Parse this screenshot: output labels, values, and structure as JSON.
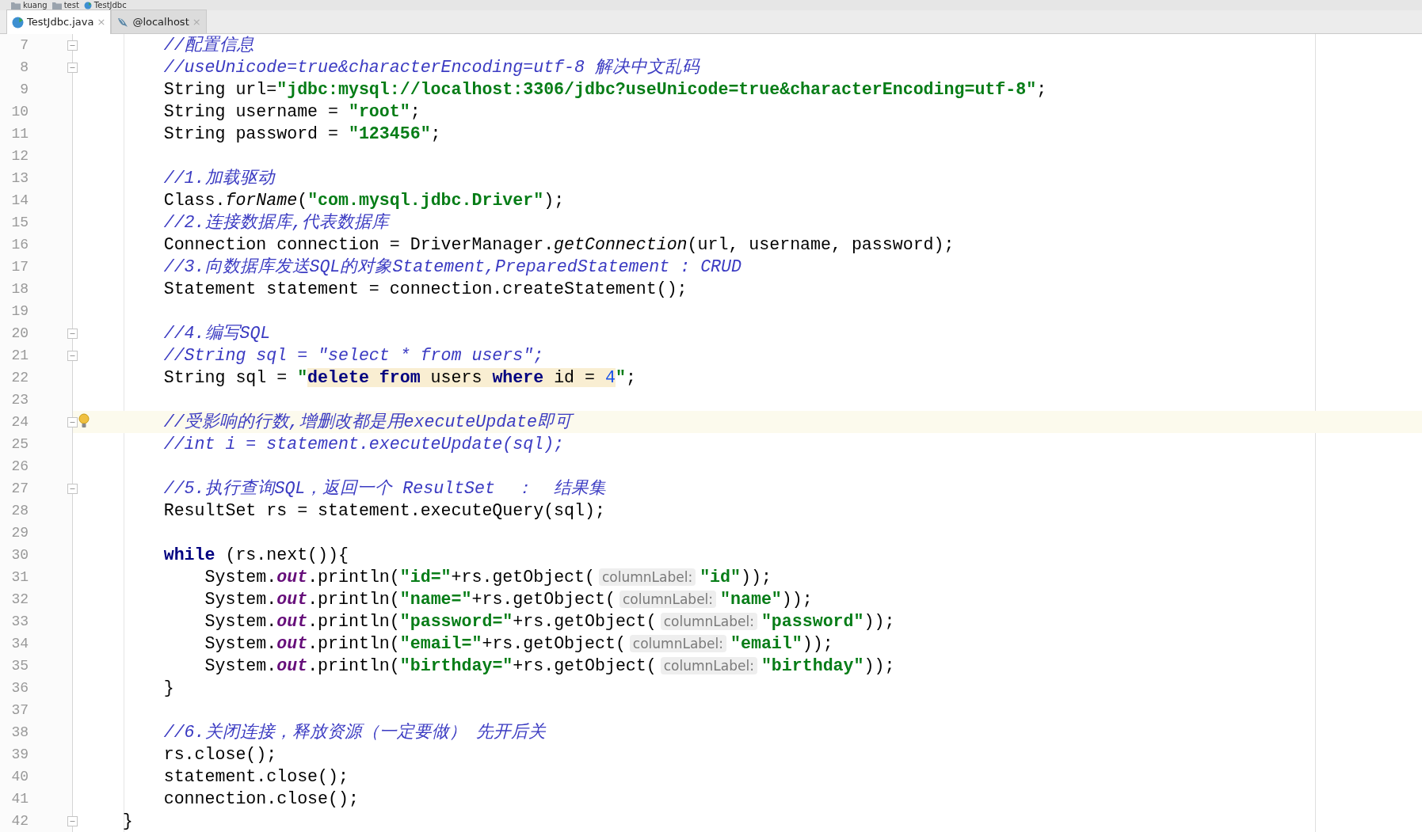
{
  "breadcrumbs": [
    {
      "kind": "folder",
      "label": "kuang"
    },
    {
      "kind": "folder",
      "label": "test"
    },
    {
      "kind": "class",
      "label": "TestJdbc"
    }
  ],
  "tabs": [
    {
      "kind": "class",
      "label": "TestJdbc.java",
      "close": "×",
      "selected": true
    },
    {
      "kind": "database",
      "label": "@localhost",
      "close": "×",
      "selected": false
    }
  ],
  "lines": [
    {
      "number": "7",
      "fold_marker": true,
      "current": false,
      "bulb": false,
      "segments": [
        {
          "kind": "comment",
          "text": "        //配置信息"
        }
      ]
    },
    {
      "number": "8",
      "fold_marker": true,
      "current": false,
      "bulb": false,
      "segments": [
        {
          "kind": "comment",
          "text": "        //useUnicode=true&characterEncoding=utf-8 解决中文乱码"
        }
      ]
    },
    {
      "number": "9",
      "fold_marker": false,
      "current": false,
      "bulb": false,
      "segments": [
        {
          "kind": "plain",
          "text": "        String url="
        },
        {
          "kind": "string",
          "text": "\"jdbc:mysql://localhost:3306/jdbc?useUnicode=true&characterEncoding=utf-8\""
        },
        {
          "kind": "plain",
          "text": ";"
        }
      ]
    },
    {
      "number": "10",
      "fold_marker": false,
      "current": false,
      "bulb": false,
      "segments": [
        {
          "kind": "plain",
          "text": "        String username = "
        },
        {
          "kind": "string",
          "text": "\"root\""
        },
        {
          "kind": "plain",
          "text": ";"
        }
      ]
    },
    {
      "number": "11",
      "fold_marker": false,
      "current": false,
      "bulb": false,
      "segments": [
        {
          "kind": "plain",
          "text": "        String password = "
        },
        {
          "kind": "string",
          "text": "\"123456\""
        },
        {
          "kind": "plain",
          "text": ";"
        }
      ]
    },
    {
      "number": "12",
      "fold_marker": false,
      "current": false,
      "bulb": false
    },
    {
      "number": "13",
      "fold_marker": false,
      "current": false,
      "bulb": false,
      "segments": [
        {
          "kind": "comment",
          "text": "        //1.加载驱动"
        }
      ]
    },
    {
      "number": "14",
      "fold_marker": false,
      "current": false,
      "bulb": false,
      "segments": [
        {
          "kind": "plain",
          "text": "        Class."
        },
        {
          "kind": "method",
          "text": "forName"
        },
        {
          "kind": "plain",
          "text": "("
        },
        {
          "kind": "string",
          "text": "\"com.mysql.jdbc.Driver\""
        },
        {
          "kind": "plain",
          "text": ");"
        }
      ]
    },
    {
      "number": "15",
      "fold_marker": false,
      "current": false,
      "bulb": false,
      "segments": [
        {
          "kind": "comment",
          "text": "        //2.连接数据库,代表数据库"
        }
      ]
    },
    {
      "number": "16",
      "fold_marker": false,
      "current": false,
      "bulb": false,
      "segments": [
        {
          "kind": "plain",
          "text": "        Connection connection = DriverManager."
        },
        {
          "kind": "method",
          "text": "getConnection"
        },
        {
          "kind": "plain",
          "text": "(url, username, password);"
        }
      ]
    },
    {
      "number": "17",
      "fold_marker": false,
      "current": false,
      "bulb": false,
      "segments": [
        {
          "kind": "comment",
          "text": "        //3.向数据库发送SQL的对象Statement,PreparedStatement : CRUD"
        }
      ]
    },
    {
      "number": "18",
      "fold_marker": false,
      "current": false,
      "bulb": false,
      "segments": [
        {
          "kind": "plain",
          "text": "        Statement statement = connection.createStatement();"
        }
      ]
    },
    {
      "number": "19",
      "fold_marker": false,
      "current": false,
      "bulb": false
    },
    {
      "number": "20",
      "fold_marker": true,
      "current": false,
      "bulb": false,
      "segments": [
        {
          "kind": "comment",
          "text": "        //4.编写SQL"
        }
      ]
    },
    {
      "number": "21",
      "fold_marker": true,
      "current": false,
      "bulb": false,
      "segments": [
        {
          "kind": "comment",
          "text": "        //String sql = \"select * from users\";"
        }
      ]
    },
    {
      "number": "22",
      "fold_marker": false,
      "current": false,
      "bulb": false,
      "segments": [
        {
          "kind": "plain",
          "text": "        String sql = "
        },
        {
          "kind": "string",
          "text": "\""
        },
        {
          "kind": "sql_keyword",
          "text": "delete from"
        },
        {
          "kind": "sql",
          "text": " users "
        },
        {
          "kind": "sql_keyword",
          "text": "where"
        },
        {
          "kind": "sql",
          "text": " id = "
        },
        {
          "kind": "sql_number",
          "text": "4"
        },
        {
          "kind": "string",
          "text": "\""
        },
        {
          "kind": "plain",
          "text": ";"
        }
      ]
    },
    {
      "number": "23",
      "fold_marker": false,
      "current": false,
      "bulb": false
    },
    {
      "number": "24",
      "fold_marker": true,
      "current": true,
      "bulb": true,
      "segments": [
        {
          "kind": "comment",
          "text": "        //受影响的行数,增删改都是用executeUpdate即可"
        }
      ]
    },
    {
      "number": "25",
      "fold_marker": false,
      "current": false,
      "bulb": false,
      "segments": [
        {
          "kind": "comment",
          "text": "        //int i = statement.executeUpdate(sql);"
        }
      ]
    },
    {
      "number": "26",
      "fold_marker": false,
      "current": false,
      "bulb": false
    },
    {
      "number": "27",
      "fold_marker": true,
      "current": false,
      "bulb": false,
      "segments": [
        {
          "kind": "comment",
          "text": "        //5.执行查询SQL，返回一个 ResultSet  ：  结果集"
        }
      ]
    },
    {
      "number": "28",
      "fold_marker": false,
      "current": false,
      "bulb": false,
      "segments": [
        {
          "kind": "plain",
          "text": "        ResultSet rs = statement.executeQuery(sql);"
        }
      ]
    },
    {
      "number": "29",
      "fold_marker": false,
      "current": false,
      "bulb": false
    },
    {
      "number": "30",
      "fold_marker": false,
      "current": false,
      "bulb": false,
      "segments": [
        {
          "kind": "keyword",
          "text": "        while"
        },
        {
          "kind": "plain",
          "text": " (rs.next()){"
        }
      ]
    },
    {
      "number": "31",
      "fold_marker": false,
      "current": false,
      "bulb": false,
      "segments": [
        {
          "kind": "plain",
          "text": "            System."
        },
        {
          "kind": "field",
          "text": "out"
        },
        {
          "kind": "plain",
          "text": ".println("
        },
        {
          "kind": "string",
          "text": "\"id=\""
        },
        {
          "kind": "plain",
          "text": "+rs.getObject("
        },
        {
          "kind": "hint",
          "text": "columnLabel:"
        },
        {
          "kind": "string",
          "text": "\"id\""
        },
        {
          "kind": "plain",
          "text": "));"
        }
      ]
    },
    {
      "number": "32",
      "fold_marker": false,
      "current": false,
      "bulb": false,
      "segments": [
        {
          "kind": "plain",
          "text": "            System."
        },
        {
          "kind": "field",
          "text": "out"
        },
        {
          "kind": "plain",
          "text": ".println("
        },
        {
          "kind": "string",
          "text": "\"name=\""
        },
        {
          "kind": "plain",
          "text": "+rs.getObject("
        },
        {
          "kind": "hint",
          "text": "columnLabel:"
        },
        {
          "kind": "string",
          "text": "\"name\""
        },
        {
          "kind": "plain",
          "text": "));"
        }
      ]
    },
    {
      "number": "33",
      "fold_marker": false,
      "current": false,
      "bulb": false,
      "segments": [
        {
          "kind": "plain",
          "text": "            System."
        },
        {
          "kind": "field",
          "text": "out"
        },
        {
          "kind": "plain",
          "text": ".println("
        },
        {
          "kind": "string",
          "text": "\"password=\""
        },
        {
          "kind": "plain",
          "text": "+rs.getObject("
        },
        {
          "kind": "hint",
          "text": "columnLabel:"
        },
        {
          "kind": "string",
          "text": "\"password\""
        },
        {
          "kind": "plain",
          "text": "));"
        }
      ]
    },
    {
      "number": "34",
      "fold_marker": false,
      "current": false,
      "bulb": false,
      "segments": [
        {
          "kind": "plain",
          "text": "            System."
        },
        {
          "kind": "field",
          "text": "out"
        },
        {
          "kind": "plain",
          "text": ".println("
        },
        {
          "kind": "string",
          "text": "\"email=\""
        },
        {
          "kind": "plain",
          "text": "+rs.getObject("
        },
        {
          "kind": "hint",
          "text": "columnLabel:"
        },
        {
          "kind": "string",
          "text": "\"email\""
        },
        {
          "kind": "plain",
          "text": "));"
        }
      ]
    },
    {
      "number": "35",
      "fold_marker": false,
      "current": false,
      "bulb": false,
      "segments": [
        {
          "kind": "plain",
          "text": "            System."
        },
        {
          "kind": "field",
          "text": "out"
        },
        {
          "kind": "plain",
          "text": ".println("
        },
        {
          "kind": "string",
          "text": "\"birthday=\""
        },
        {
          "kind": "plain",
          "text": "+rs.getObject("
        },
        {
          "kind": "hint",
          "text": "columnLabel:"
        },
        {
          "kind": "string",
          "text": "\"birthday\""
        },
        {
          "kind": "plain",
          "text": "));"
        }
      ]
    },
    {
      "number": "36",
      "fold_marker": false,
      "current": false,
      "bulb": false,
      "segments": [
        {
          "kind": "plain",
          "text": "        }"
        }
      ]
    },
    {
      "number": "37",
      "fold_marker": false,
      "current": false,
      "bulb": false
    },
    {
      "number": "38",
      "fold_marker": false,
      "current": false,
      "bulb": false,
      "segments": [
        {
          "kind": "comment",
          "text": "        //6.关闭连接，释放资源（一定要做） 先开后关"
        }
      ]
    },
    {
      "number": "39",
      "fold_marker": false,
      "current": false,
      "bulb": false,
      "segments": [
        {
          "kind": "plain",
          "text": "        rs.close();"
        }
      ]
    },
    {
      "number": "40",
      "fold_marker": false,
      "current": false,
      "bulb": false,
      "segments": [
        {
          "kind": "plain",
          "text": "        statement.close();"
        }
      ]
    },
    {
      "number": "41",
      "fold_marker": false,
      "current": false,
      "bulb": false,
      "segments": [
        {
          "kind": "plain",
          "text": "        connection.close();"
        }
      ]
    },
    {
      "number": "42",
      "fold_marker": true,
      "current": false,
      "bulb": false,
      "segments": [
        {
          "kind": "plain",
          "text": "    }"
        }
      ]
    }
  ]
}
